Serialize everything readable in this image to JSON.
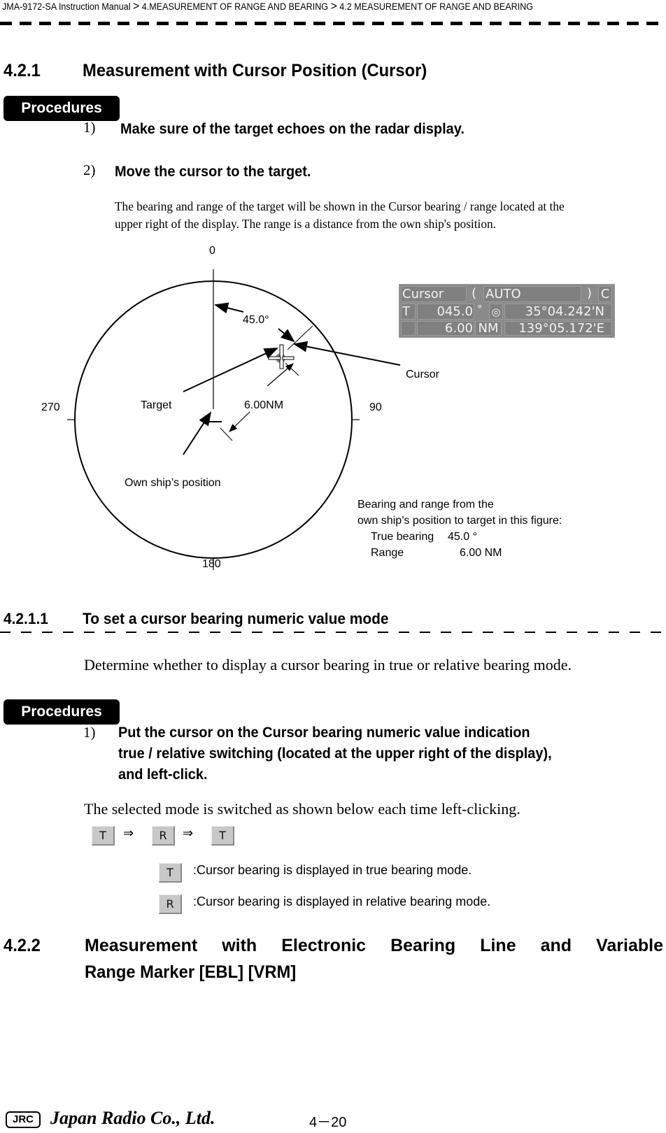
{
  "header": {
    "breadcrumb": [
      "JMA-9172-SA Instruction Manual",
      "4.MEASUREMENT OF RANGE AND BEARING",
      "4.2  MEASUREMENT OF RANGE AND BEARING"
    ],
    "separator": ">"
  },
  "section_421": {
    "number": "4.2.1",
    "title": "Measurement with Cursor Position (Cursor)"
  },
  "procedures_label": "Procedures",
  "steps_421": [
    {
      "num": "1)",
      "text": "Make sure of the target echoes on the radar display."
    },
    {
      "num": "2)",
      "text": "Move the cursor to the target."
    }
  ],
  "step2_description": [
    "The bearing and range of the target will be shown in the Cursor bearing / range located at the",
    "upper right of the display. The range is a distance from the own ship's position."
  ],
  "figure": {
    "bearing_labels": {
      "north": "0",
      "east": "90",
      "south": "180",
      "west": "270"
    },
    "angle_label": "45.0°",
    "range_label": "6.00NM",
    "target_label": "Target",
    "cursor_label": "Cursor",
    "own_ship_label": "Own ship’s position",
    "target_bearing_deg": 45.0,
    "target_range_nm": 6.0,
    "caption": {
      "line1": "Bearing and range from the",
      "line2": "own ship’s position to target in this figure:",
      "bearing_label": "True bearing",
      "bearing_value": "45.0 °",
      "range_label": "Range",
      "range_value": "6.00 NM"
    },
    "cursor_panel": {
      "title": "Cursor",
      "open_paren": "(",
      "mode": "AUTO",
      "close_paren": ")",
      "c_button": "C",
      "tr_button": "T",
      "bearing": "045.0",
      "degree": "°",
      "lat": "35°04.242'N",
      "range": "6.00",
      "range_unit": "NM",
      "lon": "139°05.172'E"
    }
  },
  "section_4211": {
    "number": "4.2.1.1",
    "title": "To set a cursor bearing numeric value mode",
    "description": "Determine whether to display a cursor bearing in true or relative bearing mode."
  },
  "steps_4211": [
    {
      "num": "1)",
      "lines": [
        "Put the cursor on the Cursor bearing numeric value indication",
        "true / relative switching (located at the upper right of the display),",
        "and left-click."
      ]
    }
  ],
  "switch_description": "The selected mode is switched as shown below each time left-clicking.",
  "switch_sequence": [
    "T",
    "R",
    "T"
  ],
  "switch_arrow": "⇒",
  "mode_legend": [
    {
      "key": "T",
      "text": ":Cursor bearing is displayed in true bearing mode."
    },
    {
      "key": "R",
      "text": ":Cursor bearing is displayed in relative bearing mode."
    }
  ],
  "section_422": {
    "number": "4.2.2",
    "title_line1": [
      "Measurement",
      "with",
      "Electronic",
      "Bearing",
      "Line",
      "and",
      "Variable"
    ],
    "title_line2": "Range Marker [EBL]  [VRM]"
  },
  "footer": {
    "logo": "JRC",
    "brand": "Japan Radio Co., Ltd.",
    "page": "4－20"
  }
}
